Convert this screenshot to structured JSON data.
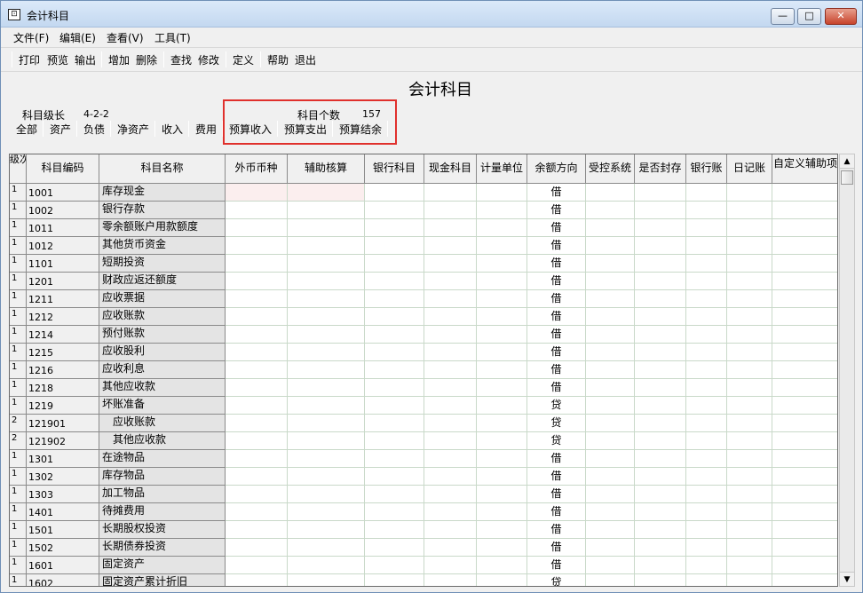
{
  "window": {
    "title": "会计科目",
    "icon": "app-window-icon",
    "controls": {
      "minimize": "—",
      "maximize": "□",
      "close": "✕"
    }
  },
  "menu": [
    "文件(F)",
    "编辑(E)",
    "查看(V)",
    "工具(T)"
  ],
  "toolbar": [
    "打印",
    "预览",
    "输出",
    "增加",
    "删除",
    "查找",
    "修改",
    "定义",
    "帮助",
    "退出"
  ],
  "header": {
    "page_title": "会计科目",
    "level_label": "科目级长",
    "level_value": "4-2-2",
    "count_label": "科目个数",
    "count_value": "157",
    "highlight_color": "#e0302c"
  },
  "tabs": [
    "全部",
    "资产",
    "负债",
    "净资产",
    "收入",
    "费用",
    "预算收入",
    "预算支出",
    "预算结余"
  ],
  "table": {
    "columns": [
      "级次",
      "科目编码",
      "科目名称",
      "外币币种",
      "辅助核算",
      "银行科目",
      "现金科目",
      "计量单位",
      "余额方向",
      "受控系统",
      "是否封存",
      "银行账",
      "日记账",
      "自定义辅助项"
    ],
    "rows": [
      {
        "level": "1",
        "code": "1001",
        "name": "库存现金",
        "direction": "借"
      },
      {
        "level": "1",
        "code": "1002",
        "name": "银行存款",
        "direction": "借"
      },
      {
        "level": "1",
        "code": "1011",
        "name": "零余额账户用款额度",
        "direction": "借"
      },
      {
        "level": "1",
        "code": "1012",
        "name": "其他货币资金",
        "direction": "借"
      },
      {
        "level": "1",
        "code": "1101",
        "name": "短期投资",
        "direction": "借"
      },
      {
        "level": "1",
        "code": "1201",
        "name": "财政应返还额度",
        "direction": "借"
      },
      {
        "level": "1",
        "code": "1211",
        "name": "应收票据",
        "direction": "借"
      },
      {
        "level": "1",
        "code": "1212",
        "name": "应收账款",
        "direction": "借"
      },
      {
        "level": "1",
        "code": "1214",
        "name": "预付账款",
        "direction": "借"
      },
      {
        "level": "1",
        "code": "1215",
        "name": "应收股利",
        "direction": "借"
      },
      {
        "level": "1",
        "code": "1216",
        "name": "应收利息",
        "direction": "借"
      },
      {
        "level": "1",
        "code": "1218",
        "name": "其他应收款",
        "direction": "借"
      },
      {
        "level": "1",
        "code": "1219",
        "name": "坏账准备",
        "direction": "贷"
      },
      {
        "level": "2",
        "code": "121901",
        "name": "应收账款",
        "direction": "贷"
      },
      {
        "level": "2",
        "code": "121902",
        "name": "其他应收款",
        "direction": "贷"
      },
      {
        "level": "1",
        "code": "1301",
        "name": "在途物品",
        "direction": "借"
      },
      {
        "level": "1",
        "code": "1302",
        "name": "库存物品",
        "direction": "借"
      },
      {
        "level": "1",
        "code": "1303",
        "name": "加工物品",
        "direction": "借"
      },
      {
        "level": "1",
        "code": "1401",
        "name": "待摊费用",
        "direction": "借"
      },
      {
        "level": "1",
        "code": "1501",
        "name": "长期股权投资",
        "direction": "借"
      },
      {
        "level": "1",
        "code": "1502",
        "name": "长期债券投资",
        "direction": "借"
      },
      {
        "level": "1",
        "code": "1601",
        "name": "固定资产",
        "direction": "借"
      },
      {
        "level": "1",
        "code": "1602",
        "name": "固定资产累计折旧",
        "direction": "贷"
      }
    ]
  },
  "scrollbar": {
    "up": "▲",
    "down": "▼"
  }
}
